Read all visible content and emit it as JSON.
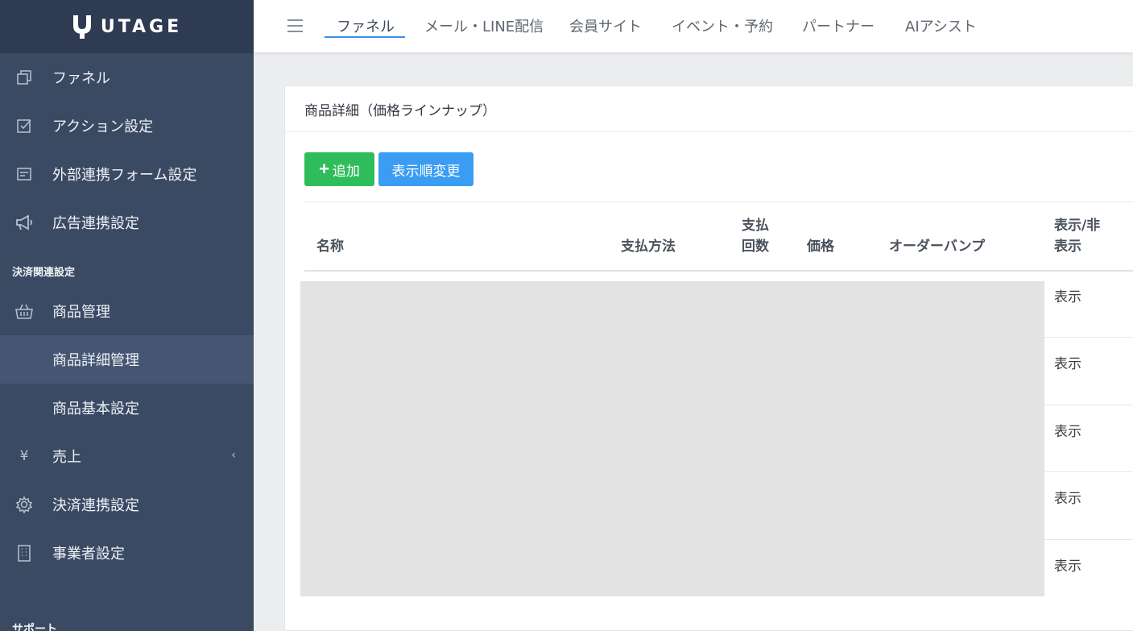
{
  "brand": {
    "name": "UTAGE"
  },
  "sidebar": {
    "items": [
      {
        "label": "ファネル",
        "icon": "funnel-copy-icon"
      },
      {
        "label": "アクション設定",
        "icon": "checkbox-icon"
      },
      {
        "label": "外部連携フォーム設定",
        "icon": "form-icon"
      },
      {
        "label": "広告連携設定",
        "icon": "megaphone-icon"
      }
    ],
    "section_label": "決済関連設定",
    "payment_items": [
      {
        "label": "商品管理",
        "icon": "basket-icon"
      },
      {
        "label": "商品詳細管理",
        "active": true
      },
      {
        "label": "商品基本設定"
      },
      {
        "label": "売上",
        "icon": "yen-icon",
        "has_children": true
      },
      {
        "label": "決済連携設定",
        "icon": "gear-icon"
      },
      {
        "label": "事業者設定",
        "icon": "building-icon"
      }
    ],
    "next_section_partial": "サポート"
  },
  "topbar": {
    "tabs": [
      {
        "label": "ファネル",
        "active": true
      },
      {
        "label": "メール・LINE配信"
      },
      {
        "label": "会員サイト"
      },
      {
        "label": "イベント・予約"
      },
      {
        "label": "パートナー"
      },
      {
        "label": "AIアシスト"
      }
    ]
  },
  "card": {
    "title": "商品詳細（価格ラインナップ）",
    "add_button": "追加",
    "order_button": "表示順変更",
    "columns": {
      "name": "名称",
      "payment_method": "支払方法",
      "payment_count_1": "支払",
      "payment_count_2": "回数",
      "price": "価格",
      "order_bump": "オーダーバンプ",
      "visibility_1": "表示/非",
      "visibility_2": "表示"
    },
    "rows": [
      {
        "visibility": "表示"
      },
      {
        "visibility": "表示"
      },
      {
        "visibility": "表示"
      },
      {
        "visibility": "表示"
      },
      {
        "visibility": "表示"
      }
    ]
  },
  "colors": {
    "sidebar_bg": "#3b4a63",
    "brand_bg": "#2f3b52",
    "active_item_bg": "#465672",
    "add_button": "#2ebd5a",
    "order_button": "#3a9cf3",
    "tab_underline": "#3a8fe8"
  }
}
